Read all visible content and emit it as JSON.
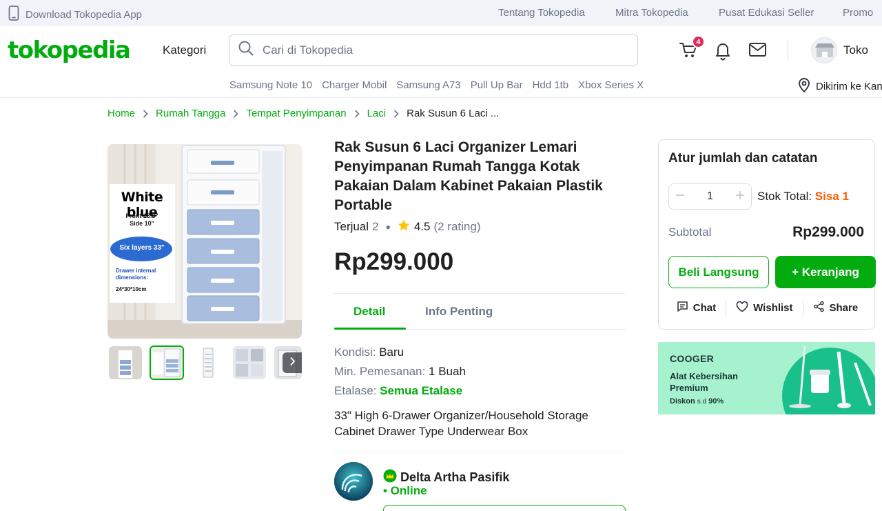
{
  "topbar": {
    "download_label": "Download Tokopedia App",
    "links": [
      "Tentang Tokopedia",
      "Mitra Tokopedia",
      "Pusat Edukasi Seller",
      "Promo"
    ]
  },
  "header": {
    "logo": "tokopedia",
    "category_label": "Kategori",
    "search_placeholder": "Cari di Tokopedia",
    "cart_badge": "4",
    "shop_label": "Toko",
    "keywords": [
      "Samsung Note 10",
      "Charger Mobil",
      "Samsung A73",
      "Pull Up Bar",
      "Hdd 1tb",
      "Xbox Series X"
    ],
    "delivery_label": "Dikirim ke Kan"
  },
  "breadcrumb": [
    "Home",
    "Rumah Tangga",
    "Tempat Penyimpanan",
    "Laci",
    "Rak Susun 6 Laci ..."
  ],
  "gallery": {
    "image_texts": {
      "badge_title": "White blue",
      "dim_front": "Front 13.8\"",
      "dim_side": "Side 10\"",
      "layers": "Six layers 33\"",
      "internal_label": "Drawer internal dimensions:",
      "internal_size": "24*30*10cm"
    }
  },
  "product": {
    "title": "Rak Susun 6 Laci Organizer Lemari Penyimpanan Rumah Tangga Kotak Pakaian Dalam Kabinet Pakaian Plastik Portable",
    "sold_label": "Terjual",
    "sold_count": "2",
    "rating": "4.5",
    "rating_count": "(2 rating)",
    "price": "Rp299.000",
    "tabs": [
      "Detail",
      "Info Penting"
    ],
    "condition_label": "Kondisi: ",
    "condition_value": "Baru",
    "min_order_label": "Min. Pemesanan: ",
    "min_order_value": "1 Buah",
    "showcase_label": "Etalase: ",
    "showcase_value": "Semua Etalase",
    "description": "33\" High 6-Drawer Organizer/Household Storage Cabinet Drawer Type Underwear Box"
  },
  "seller": {
    "name": "Delta Artha Pasifik",
    "status": "• Online"
  },
  "purchase_card": {
    "title": "Atur jumlah dan catatan",
    "quantity": "1",
    "stock_label": "Stok Total: ",
    "stock_value": "Sisa 1",
    "subtotal_label": "Subtotal",
    "subtotal_value": "Rp299.000",
    "buy_now": "Beli Langsung",
    "add_to_cart": "+ Keranjang",
    "actions": [
      "Chat",
      "Wishlist",
      "Share"
    ]
  },
  "banner": {
    "brand": "COOGER",
    "title_line1": "Alat Kebersihan",
    "title_line2": "Premium",
    "subtitle_prefix": "Diskon ",
    "subtitle_small": "s.d",
    "subtitle_value": " 90%"
  },
  "colors": {
    "brand_green": "#03ac0e",
    "badge_red": "#e02954",
    "stock_orange": "#ff5c00",
    "banner_mint": "#a6f2cf"
  }
}
